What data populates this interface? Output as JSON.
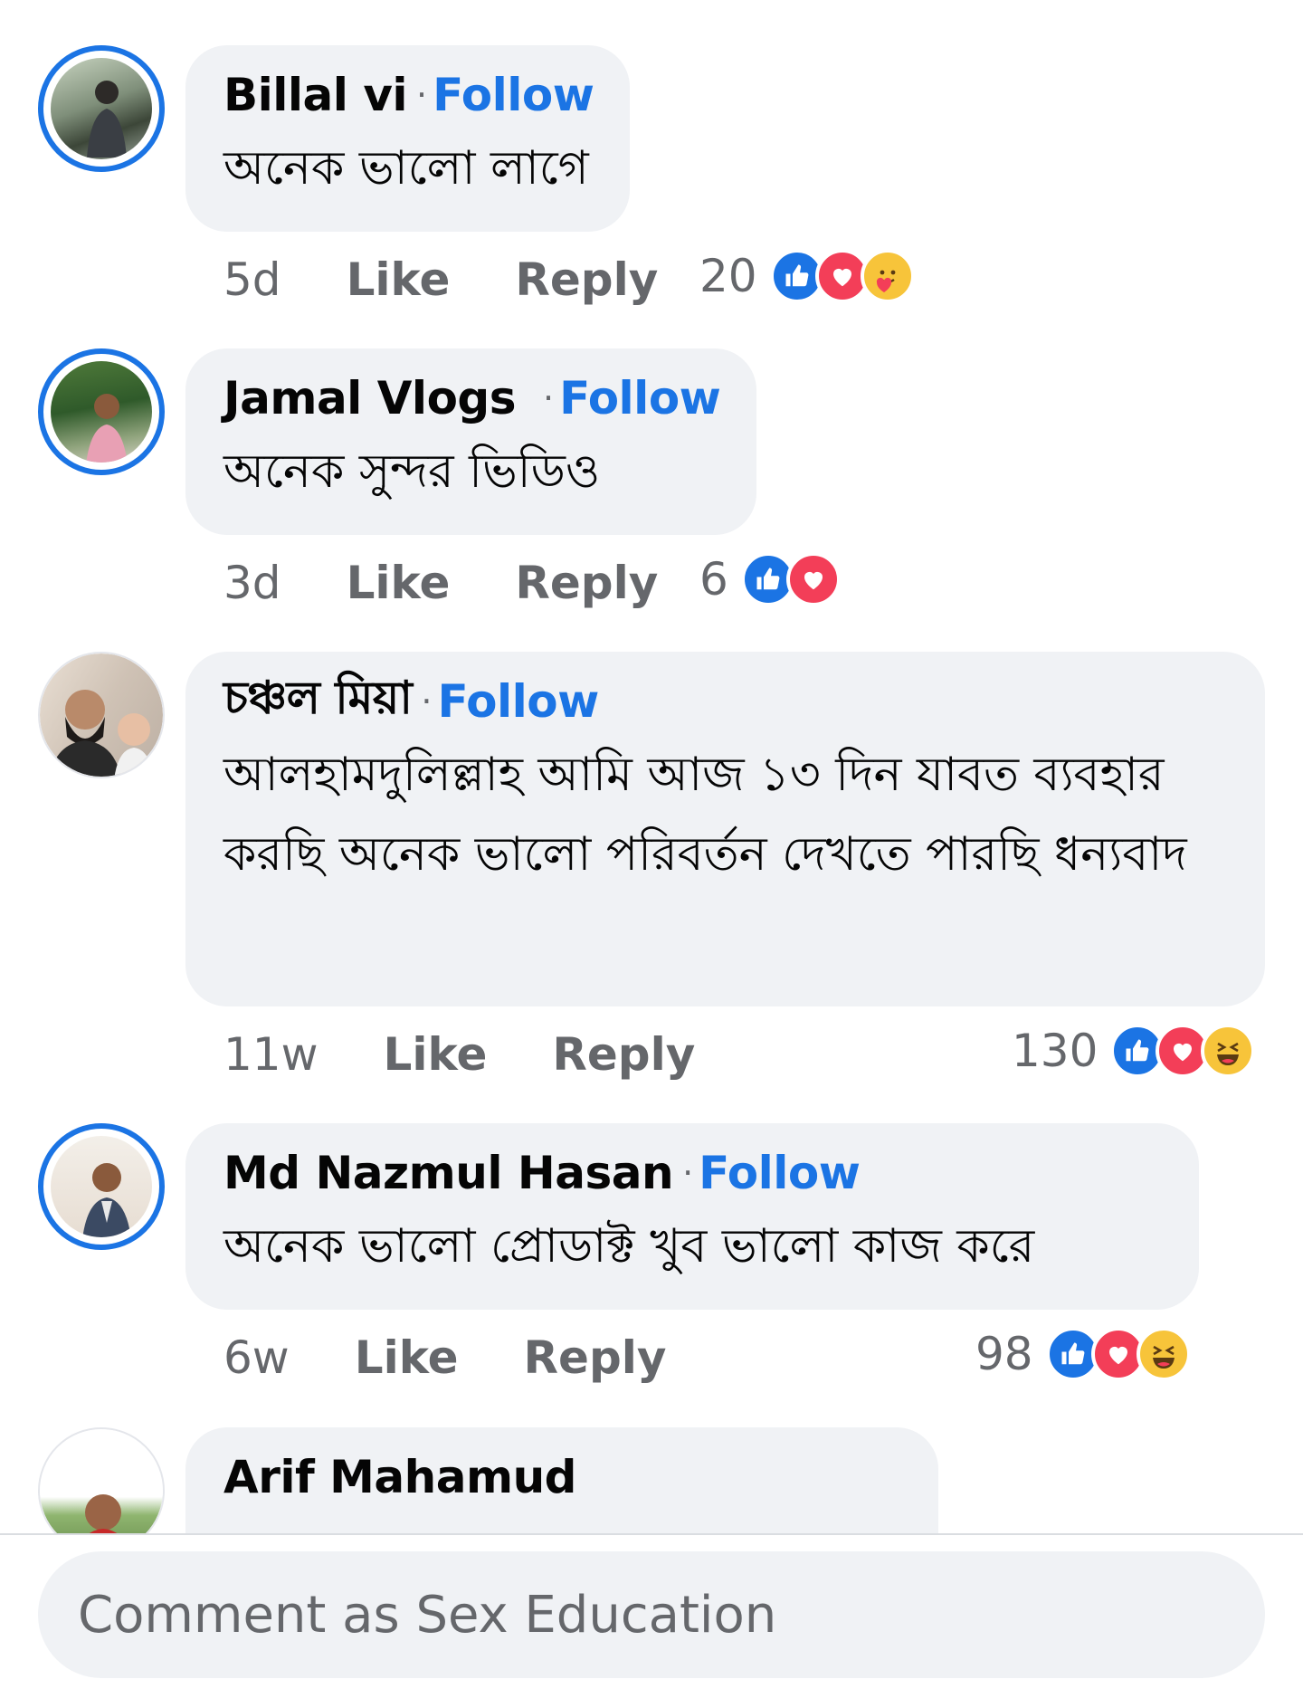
{
  "follow_label": "Follow",
  "like_label": "Like",
  "reply_label": "Reply",
  "comments": [
    {
      "author": "Billal vi",
      "text": "অনেক ভালো লাগে",
      "time": "5d",
      "reaction_count": "20",
      "reactions": [
        "like",
        "love",
        "care"
      ]
    },
    {
      "author": "Jamal Vlogs",
      "text": "অনেক সুন্দর ভিডিও",
      "time": "3d",
      "reaction_count": "6",
      "reactions": [
        "like",
        "love"
      ]
    },
    {
      "author": "চঞ্চল মিয়া",
      "text": "আলহামদুলিল্লাহ আমি আজ ১৩ দিন যাবত ব্যবহার করছি অনেক ভালো পরিবর্তন দেখতে পারছি ধন্যবাদ",
      "time": "11w",
      "reaction_count": "130",
      "reactions": [
        "like",
        "love",
        "haha"
      ]
    },
    {
      "author": "Md Nazmul Hasan",
      "text": "অনেক ভালো প্রোডাক্ট খুব ভালো কাজ করে",
      "time": "6w",
      "reaction_count": "98",
      "reactions": [
        "like",
        "love",
        "haha"
      ]
    },
    {
      "author": "Arif Mahamud"
    }
  ],
  "composer": {
    "placeholder": "Comment as Sex Education"
  },
  "colors": {
    "accent": "#1b74e4",
    "bubble": "#f0f2f5",
    "secondary_text": "#65676b",
    "love": "#f33e58",
    "haha": "#f7c43a"
  }
}
